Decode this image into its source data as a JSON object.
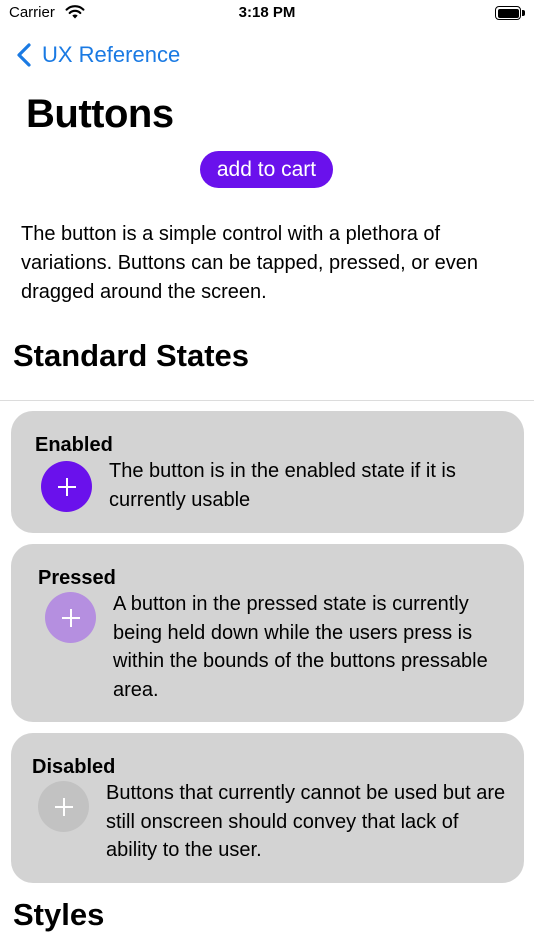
{
  "status_bar": {
    "carrier": "Carrier",
    "time": "3:18 PM"
  },
  "nav": {
    "back_label": "UX Reference"
  },
  "page": {
    "title": "Buttons",
    "cta_label": "add to cart",
    "description": "The button is a simple control with a plethora of variations. Buttons can be tapped, pressed, or even dragged around the screen."
  },
  "sections": {
    "standard_states": "Standard States",
    "styles": "Styles"
  },
  "states": [
    {
      "title": "Enabled",
      "text": "The button is in the enabled state if it is currently usable",
      "color": "#6a11ec"
    },
    {
      "title": "Pressed",
      "text": "A button in the pressed state is currently being held down while the users press is within the bounds of the buttons pressable area.",
      "color": "#b58fe0"
    },
    {
      "title": "Disabled",
      "text": "Buttons that currently cannot be used but are still onscreen should convey that lack of ability to the user.",
      "color": "#c2c2c2"
    }
  ],
  "colors": {
    "accent": "#6a11ec",
    "link": "#1a7ae3",
    "card_bg": "#d3d3d3"
  },
  "icons": {
    "back": "chevron-left-icon",
    "add": "plus-icon",
    "wifi": "wifi-icon",
    "battery": "battery-icon"
  }
}
